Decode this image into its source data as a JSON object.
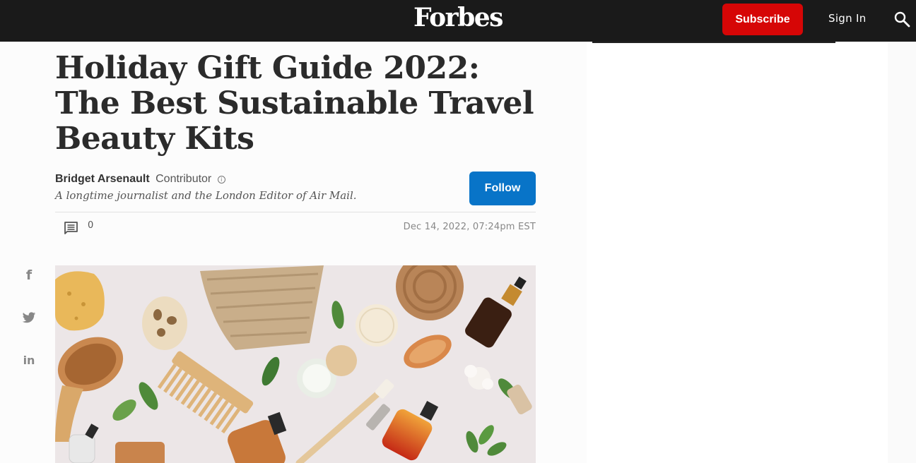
{
  "header": {
    "logo": "Forbes",
    "subscribe_label": "Subscribe",
    "signin_label": "Sign In",
    "search_icon": "search-icon"
  },
  "article": {
    "title": "Holiday Gift Guide 2022: The Best Sustainable Travel Beauty Kits",
    "author": "Bridget Arsenault",
    "role": "Contributor",
    "bio": "A longtime journalist and the London Editor of Air Mail.",
    "follow_label": "Follow",
    "comment_count": "0",
    "timestamp": "Dec 14, 2022, 07:24pm EST"
  },
  "share": {
    "facebook": "f",
    "twitter": "twitter-icon",
    "linkedin": "in"
  },
  "colors": {
    "topbar": "#1a1a1a",
    "subscribe": "#d60606",
    "follow": "#0874c8"
  }
}
